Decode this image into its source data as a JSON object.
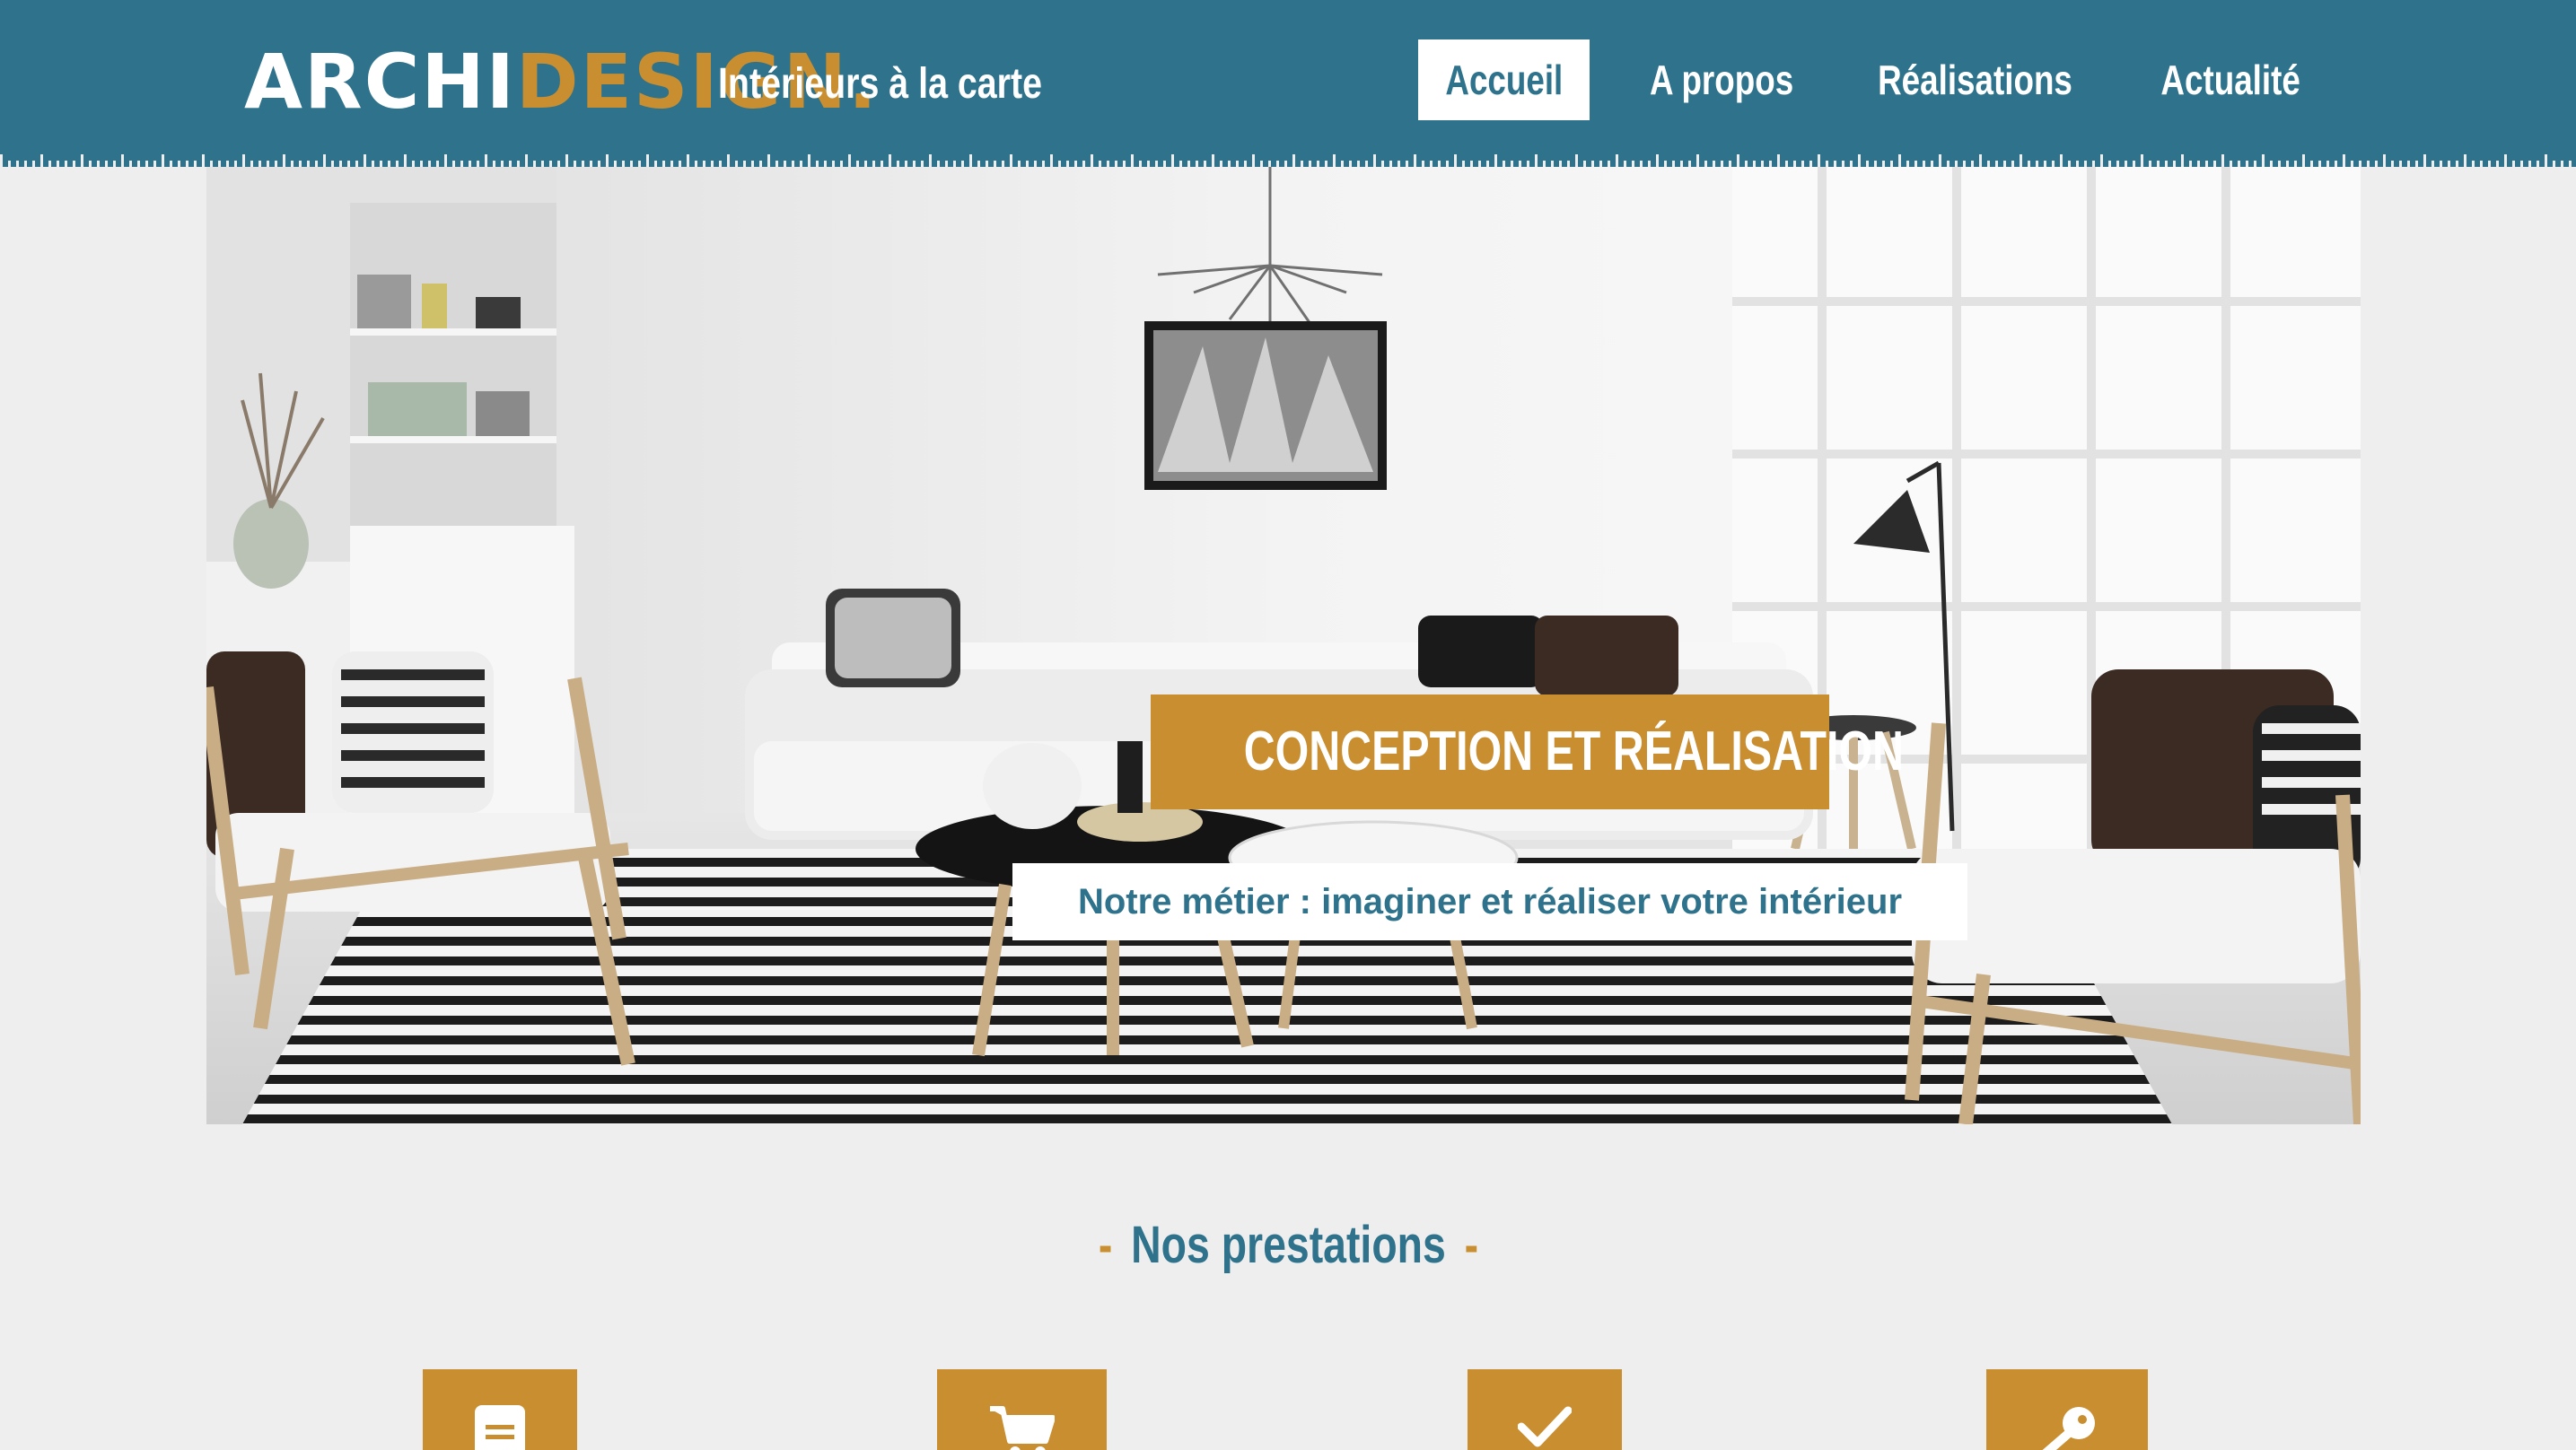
{
  "brand": {
    "logo_archi": "ARCHI",
    "logo_design": "DESIGN",
    "logo_dot": ".",
    "tagline": "Intérieurs à la carte"
  },
  "nav": {
    "items": [
      {
        "label": "Accueil",
        "active": true
      },
      {
        "label": "A propos",
        "active": false
      },
      {
        "label": "Réalisations",
        "active": false
      },
      {
        "label": "Actualité",
        "active": false
      }
    ]
  },
  "hero": {
    "title": "CONCEPTION ET RÉALISATION",
    "subtitle": "Notre métier : imaginer et réaliser votre intérieur"
  },
  "services": {
    "heading": "Nos prestations",
    "dash_left": "-",
    "dash_right": "-",
    "icons": [
      "document-icon",
      "cart-icon",
      "check-icon",
      "key-icon"
    ]
  },
  "colors": {
    "primary": "#2e728c",
    "accent": "#c98e30",
    "background": "#eeeeee"
  }
}
